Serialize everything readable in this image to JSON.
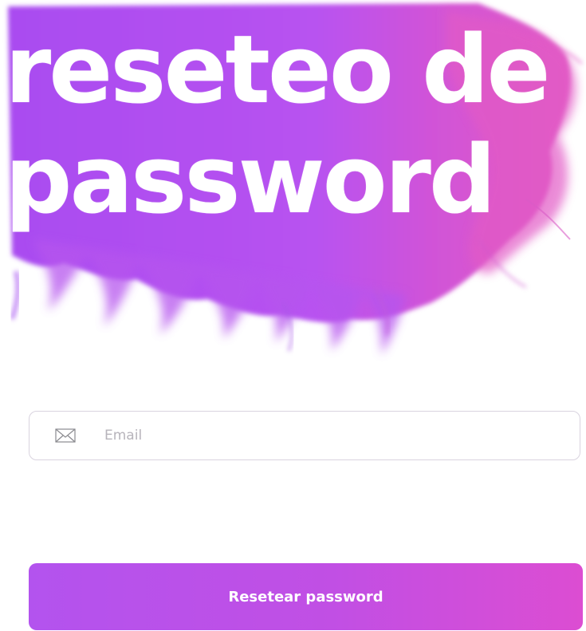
{
  "hero": {
    "title": "reseteo de\npassword"
  },
  "form": {
    "email_placeholder": "Email",
    "email_value": "",
    "submit_label": "Resetear password"
  },
  "colors": {
    "smoke_purple": "#b452f2",
    "smoke_magenta": "#e055c8",
    "button_start": "#b353ee",
    "button_end": "#dc4dd2",
    "input_border": "#d9d3df",
    "placeholder": "#b7b4bb"
  },
  "icons": {
    "email": "envelope-icon"
  }
}
